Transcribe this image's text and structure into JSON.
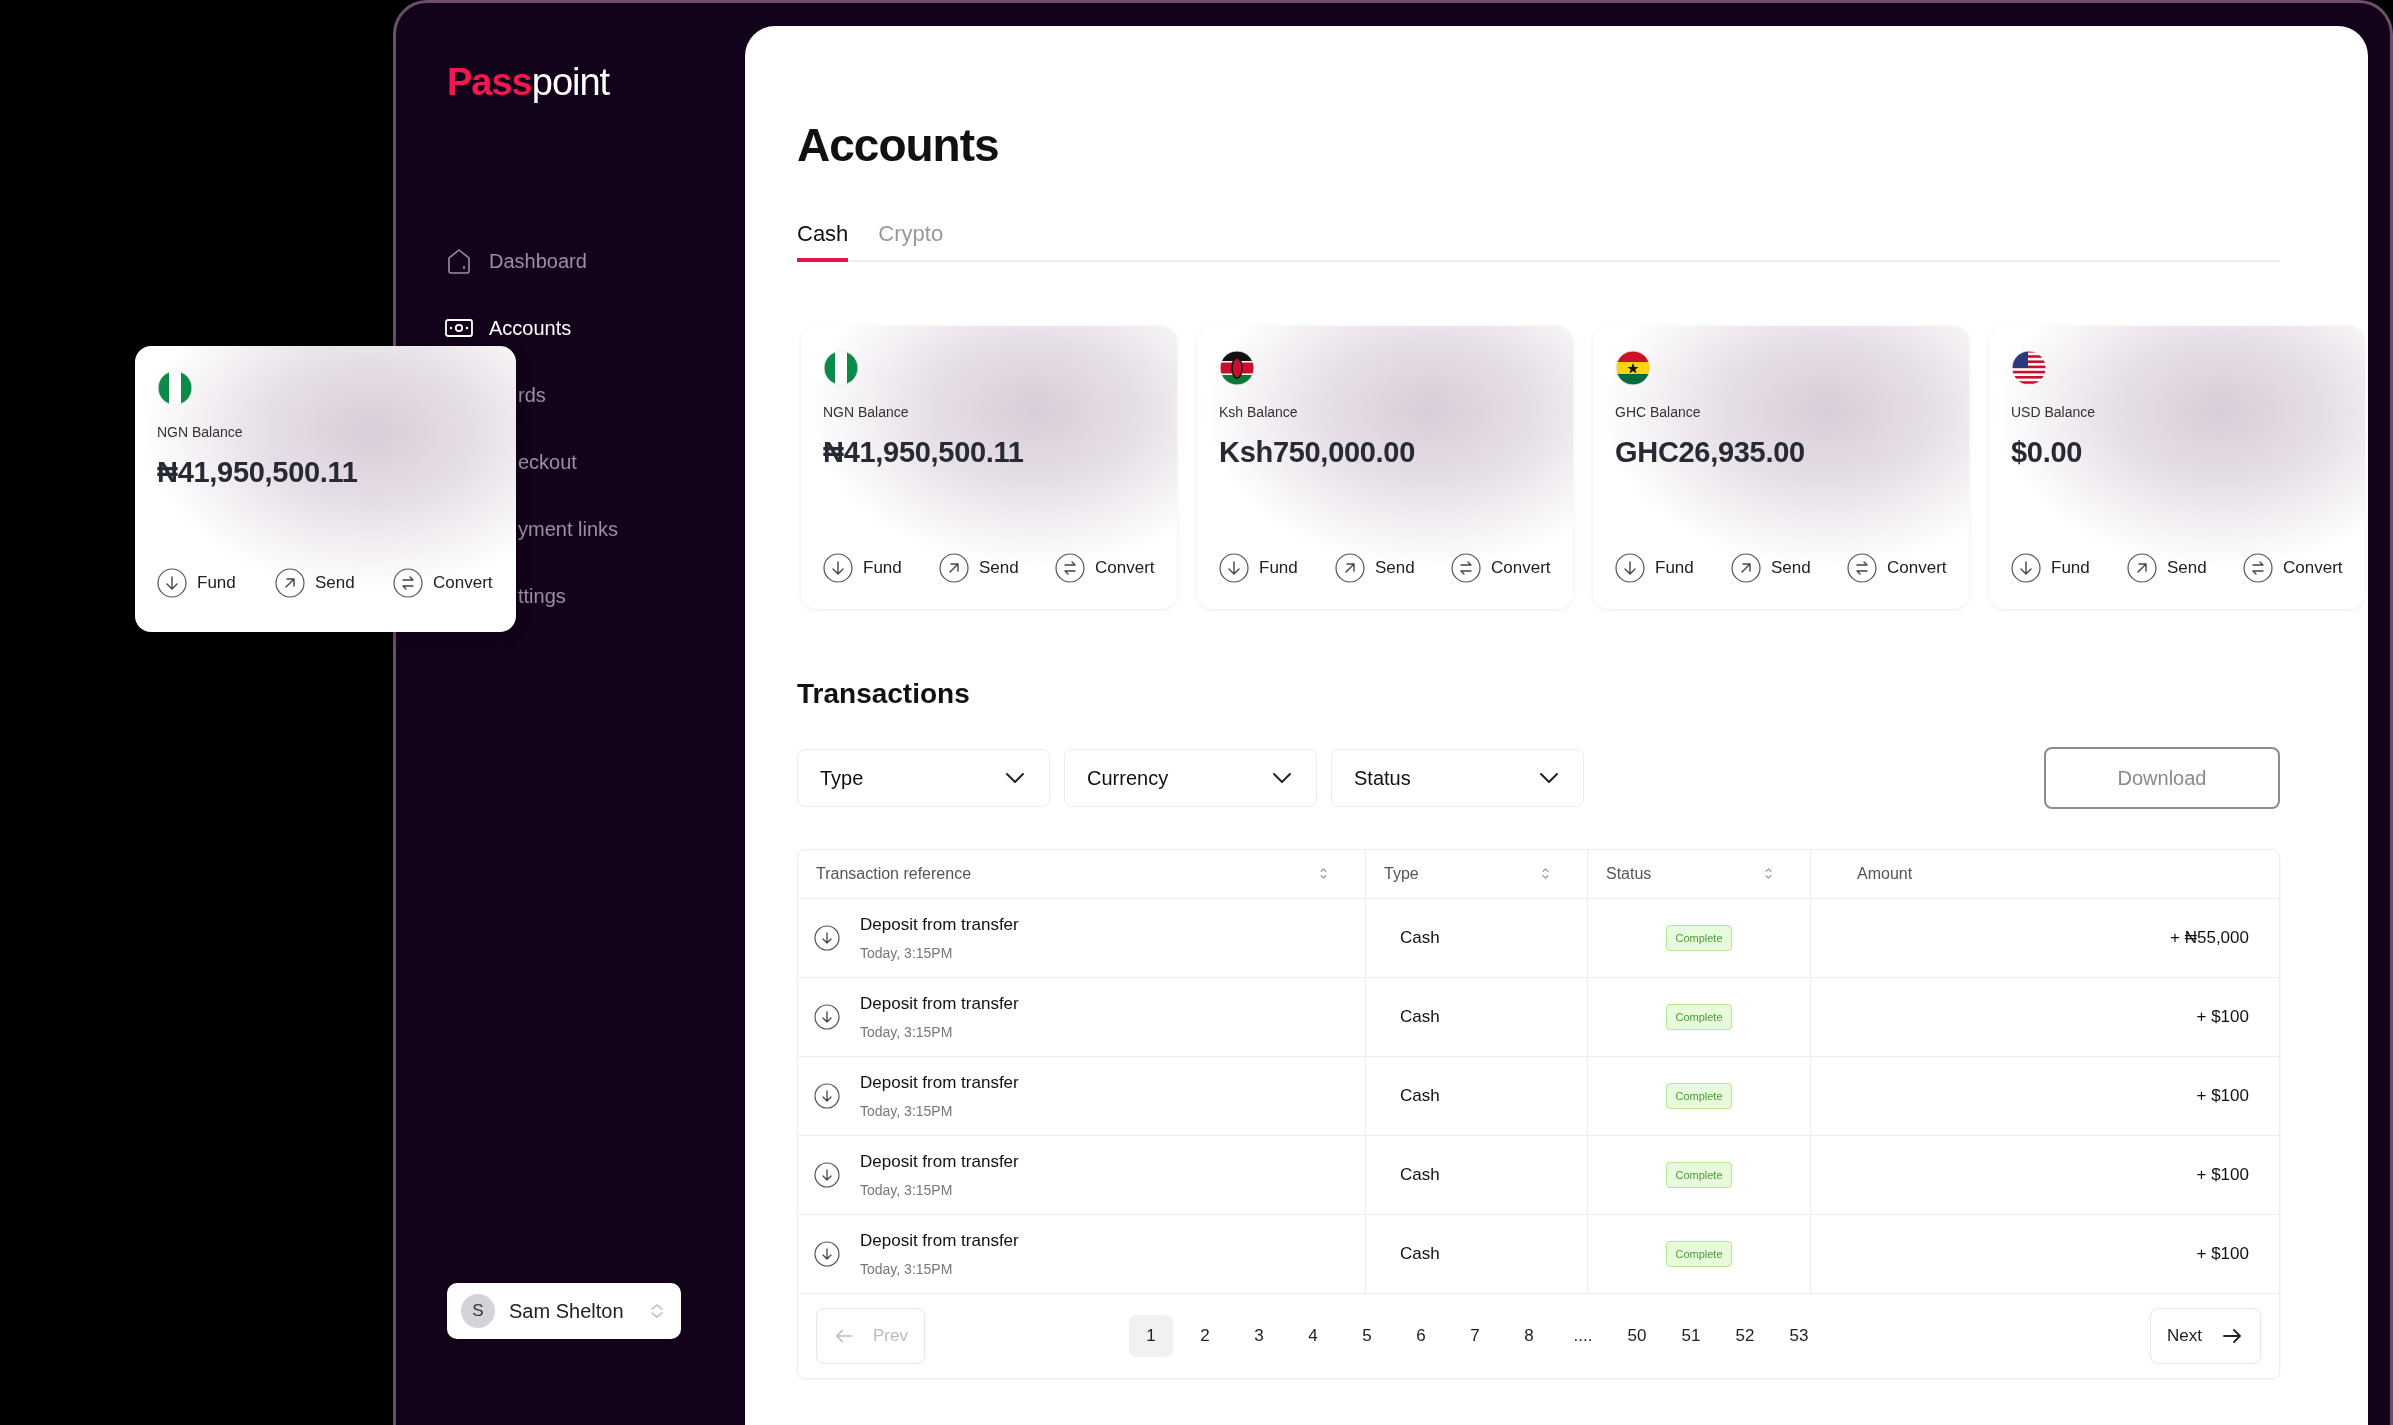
{
  "sidebar": {
    "logo": [
      "Pass",
      "point"
    ],
    "items": [
      {
        "label": "Dashboard",
        "kind": "home",
        "selected": false
      },
      {
        "label": "Accounts",
        "kind": "money",
        "selected": true
      },
      {
        "label": "rds",
        "kind": "covered",
        "selected": false
      },
      {
        "label": "eckout",
        "kind": "covered",
        "selected": false
      },
      {
        "label": "yment links",
        "kind": "covered",
        "selected": false
      },
      {
        "label": "ttings",
        "kind": "covered",
        "selected": false
      }
    ],
    "user": {
      "initial": "S",
      "name": "Sam Shelton"
    }
  },
  "floating_card": {
    "kind": "ng",
    "label": "NGN Balance",
    "amount": "₦41,950,500.11",
    "actions": [
      {
        "label": "Fund",
        "kind": "fund"
      },
      {
        "label": "Send",
        "kind": "send"
      },
      {
        "label": "Convert",
        "kind": "convert"
      }
    ]
  },
  "page": {
    "title": "Accounts",
    "tabs": [
      {
        "label": "Cash",
        "selected": true
      },
      {
        "label": "Crypto",
        "selected": false
      }
    ],
    "cards": [
      {
        "kind": "ng",
        "label": "NGN Balance",
        "amount": "₦41,950,500.11",
        "actions": [
          {
            "label": "Fund",
            "kind": "fund"
          },
          {
            "label": "Send",
            "kind": "send"
          },
          {
            "label": "Convert",
            "kind": "convert"
          }
        ]
      },
      {
        "kind": "ke",
        "label": "Ksh Balance",
        "amount": "Ksh750,000.00",
        "actions": [
          {
            "label": "Fund",
            "kind": "fund"
          },
          {
            "label": "Send",
            "kind": "send"
          },
          {
            "label": "Convert",
            "kind": "convert"
          }
        ]
      },
      {
        "kind": "gh",
        "label": "GHC Balance",
        "amount": "GHC26,935.00",
        "actions": [
          {
            "label": "Fund",
            "kind": "fund"
          },
          {
            "label": "Send",
            "kind": "send"
          },
          {
            "label": "Convert",
            "kind": "convert"
          }
        ]
      },
      {
        "kind": "us",
        "label": "USD Balance",
        "amount": "$0.00",
        "actions": [
          {
            "label": "Fund",
            "kind": "fund"
          },
          {
            "label": "Send",
            "kind": "send"
          },
          {
            "label": "Convert",
            "kind": "convert"
          }
        ]
      }
    ],
    "transactions": {
      "title": "Transactions",
      "filters": [
        "Type",
        "Currency",
        "Status"
      ],
      "download": "Download",
      "columns": [
        {
          "label": "Transaction reference",
          "sortable": true
        },
        {
          "label": "Type",
          "sortable": true
        },
        {
          "label": "Status",
          "sortable": true
        },
        {
          "label": "Amount",
          "sortable": false
        }
      ],
      "rows": [
        {
          "title": "Deposit from transfer",
          "time": "Today, 3:15PM",
          "type": "Cash",
          "status": "Complete",
          "amount": "+ ₦55,000"
        },
        {
          "title": "Deposit from transfer",
          "time": "Today, 3:15PM",
          "type": "Cash",
          "status": "Complete",
          "amount": "+ $100"
        },
        {
          "title": "Deposit from transfer",
          "time": "Today, 3:15PM",
          "type": "Cash",
          "status": "Complete",
          "amount": "+ $100"
        },
        {
          "title": "Deposit from transfer",
          "time": "Today, 3:15PM",
          "type": "Cash",
          "status": "Complete",
          "amount": "+ $100"
        },
        {
          "title": "Deposit from transfer",
          "time": "Today, 3:15PM",
          "type": "Cash",
          "status": "Complete",
          "amount": "+ $100"
        }
      ],
      "pagination": {
        "prev": {
          "label": "Prev",
          "disabled": true
        },
        "next": {
          "label": "Next",
          "disabled": false
        },
        "pages": [
          {
            "label": "1",
            "selected": true
          },
          {
            "label": "2",
            "selected": false
          },
          {
            "label": "3",
            "selected": false
          },
          {
            "label": "4",
            "selected": false
          },
          {
            "label": "5",
            "selected": false
          },
          {
            "label": "6",
            "selected": false
          },
          {
            "label": "7",
            "selected": false
          },
          {
            "label": "8",
            "selected": false
          },
          {
            "label": "....",
            "selected": false
          },
          {
            "label": "50",
            "selected": false
          },
          {
            "label": "51",
            "selected": false
          },
          {
            "label": "52",
            "selected": false
          },
          {
            "label": "53",
            "selected": false
          }
        ]
      }
    }
  }
}
